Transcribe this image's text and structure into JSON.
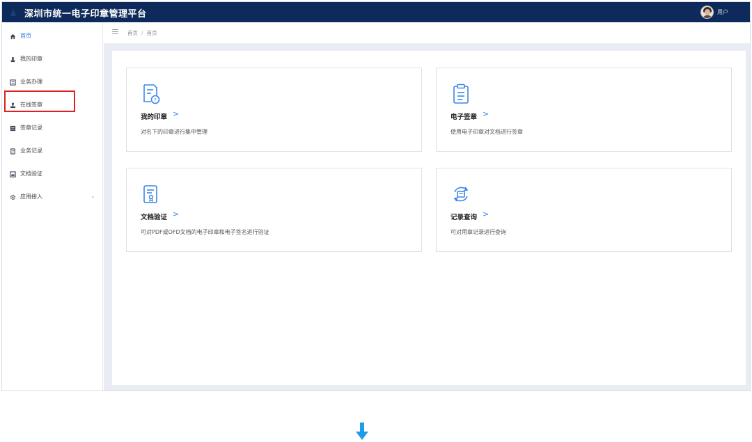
{
  "header": {
    "app_title": "深圳市统一电子印章管理平台",
    "username": "用户"
  },
  "sidebar": {
    "items": [
      {
        "label": "首页",
        "icon": "home-icon",
        "active": true
      },
      {
        "label": "我的印章",
        "icon": "seal-icon",
        "active": false
      },
      {
        "label": "业务办理",
        "icon": "document-icon",
        "active": false
      },
      {
        "label": "在线签章",
        "icon": "stamp-icon",
        "active": false
      },
      {
        "label": "签章记录",
        "icon": "record-icon",
        "active": false
      },
      {
        "label": "业务记录",
        "icon": "log-icon",
        "active": false
      },
      {
        "label": "文档验证",
        "icon": "verify-icon",
        "active": false
      },
      {
        "label": "应用接入",
        "icon": "gear-icon",
        "active": false,
        "expandable": true
      }
    ]
  },
  "breadcrumb": {
    "items": [
      "首页",
      "首页"
    ],
    "separator": "/"
  },
  "cards": [
    {
      "title": "我的印章",
      "arrow": ">",
      "desc": "对名下的印章进行集中管理",
      "icon": "seal-document-icon"
    },
    {
      "title": "电子签章",
      "arrow": ">",
      "desc": "使用电子印章对文档进行签章",
      "icon": "clipboard-icon"
    },
    {
      "title": "文档验证",
      "arrow": ">",
      "desc": "可对PDF或OFD文档的电子印章和电子签名进行验证",
      "icon": "document-verify-icon"
    },
    {
      "title": "记录查询",
      "arrow": ">",
      "desc": "可对用章记录进行查询",
      "icon": "record-refresh-icon"
    }
  ],
  "colors": {
    "topbar": "#0d2a5a",
    "accent": "#2a7ae2",
    "highlight": "#e02020",
    "down_arrow": "#1e9be9"
  }
}
